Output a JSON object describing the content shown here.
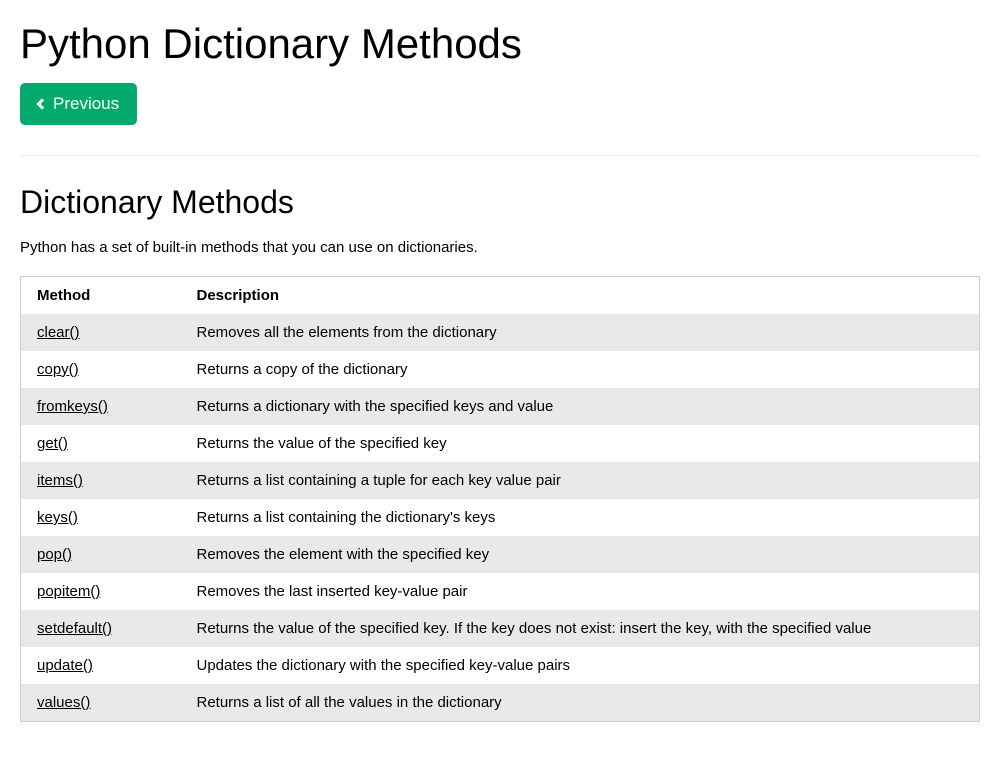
{
  "page": {
    "title": "Python Dictionary Methods",
    "prev_label": "Previous",
    "section_heading": "Dictionary Methods",
    "intro": "Python has a set of built-in methods that you can use on dictionaries."
  },
  "table": {
    "headers": {
      "method": "Method",
      "description": "Description"
    },
    "rows": [
      {
        "method": "clear()",
        "description": "Removes all the elements from the dictionary"
      },
      {
        "method": "copy()",
        "description": "Returns a copy of the dictionary"
      },
      {
        "method": "fromkeys()",
        "description": "Returns a dictionary with the specified keys and value"
      },
      {
        "method": "get()",
        "description": "Returns the value of the specified key"
      },
      {
        "method": "items()",
        "description": "Returns a list containing a tuple for each key value pair"
      },
      {
        "method": "keys()",
        "description": "Returns a list containing the dictionary's keys"
      },
      {
        "method": "pop()",
        "description": "Removes the element with the specified key"
      },
      {
        "method": "popitem()",
        "description": "Removes the last inserted key-value pair"
      },
      {
        "method": "setdefault()",
        "description": "Returns the value of the specified key. If the key does not exist: insert the key, with the specified value"
      },
      {
        "method": "update()",
        "description": "Updates the dictionary with the specified key-value pairs"
      },
      {
        "method": "values()",
        "description": "Returns a list of all the values in the dictionary"
      }
    ]
  }
}
